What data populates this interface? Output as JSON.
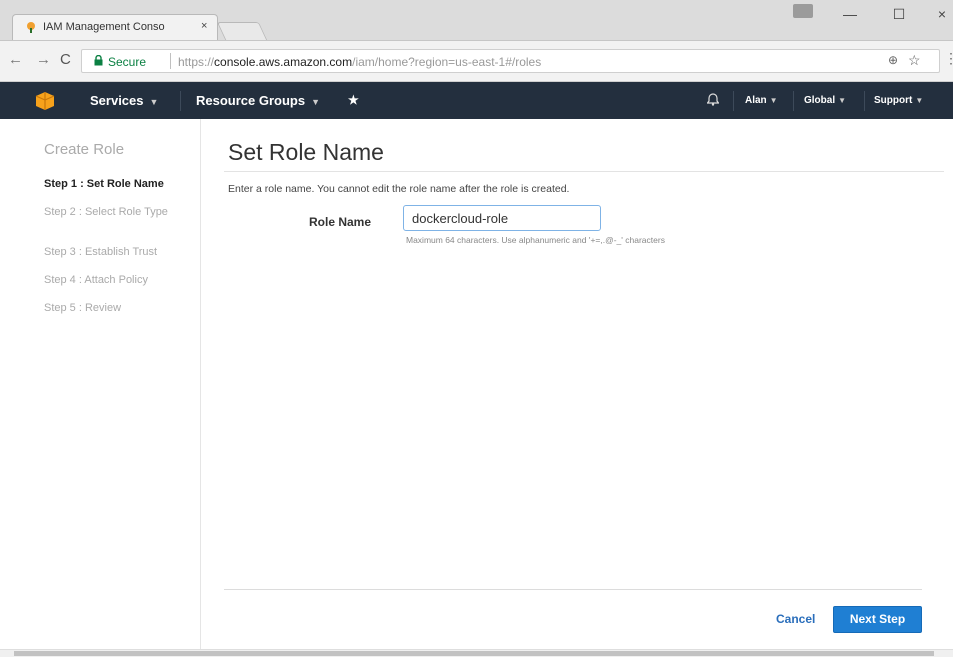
{
  "browser": {
    "tab_title": "IAM Management Conso",
    "tab_close": "×",
    "secure_label": "Secure",
    "url_prefix": "https://",
    "url_host": "console.aws.amazon.com",
    "url_path": "/iam/home?region=us-east-1#/roles",
    "window_minimize": "—",
    "window_maximize": "☐",
    "window_close": "×",
    "icons": [
      "back-icon",
      "forward-icon",
      "reload-icon",
      "lock-icon",
      "zoom-icon",
      "star-icon",
      "menu-icon",
      "profile-icon"
    ]
  },
  "aws_nav": {
    "services": "Services",
    "resource_groups": "Resource Groups",
    "pin_icon": "★",
    "bell_icon": "🔔",
    "user": "Alan",
    "region": "Global",
    "support": "Support"
  },
  "sidebar": {
    "title": "Create Role",
    "steps": [
      {
        "label": "Step 1 : Set Role Name"
      },
      {
        "label": "Step 2 : Select Role Type"
      },
      {
        "label": "Step 3 : Establish Trust"
      },
      {
        "label": "Step 4 : Attach Policy"
      },
      {
        "label": "Step 5 : Review"
      }
    ]
  },
  "main": {
    "title": "Set Role Name",
    "intro": "Enter a role name. You cannot edit the role name after the role is created.",
    "role_name_label": "Role Name",
    "role_name_value": "dockercloud-role",
    "role_name_hint": "Maximum 64 characters. Use alphanumeric and '+=,.@-_' characters",
    "cancel_label": "Cancel",
    "next_label": "Next Step"
  },
  "colors": {
    "aws_nav_bg": "#232f3e",
    "primary_button": "#1f7fd3",
    "link": "#2a6ebb",
    "secure_green": "#0b8043"
  }
}
